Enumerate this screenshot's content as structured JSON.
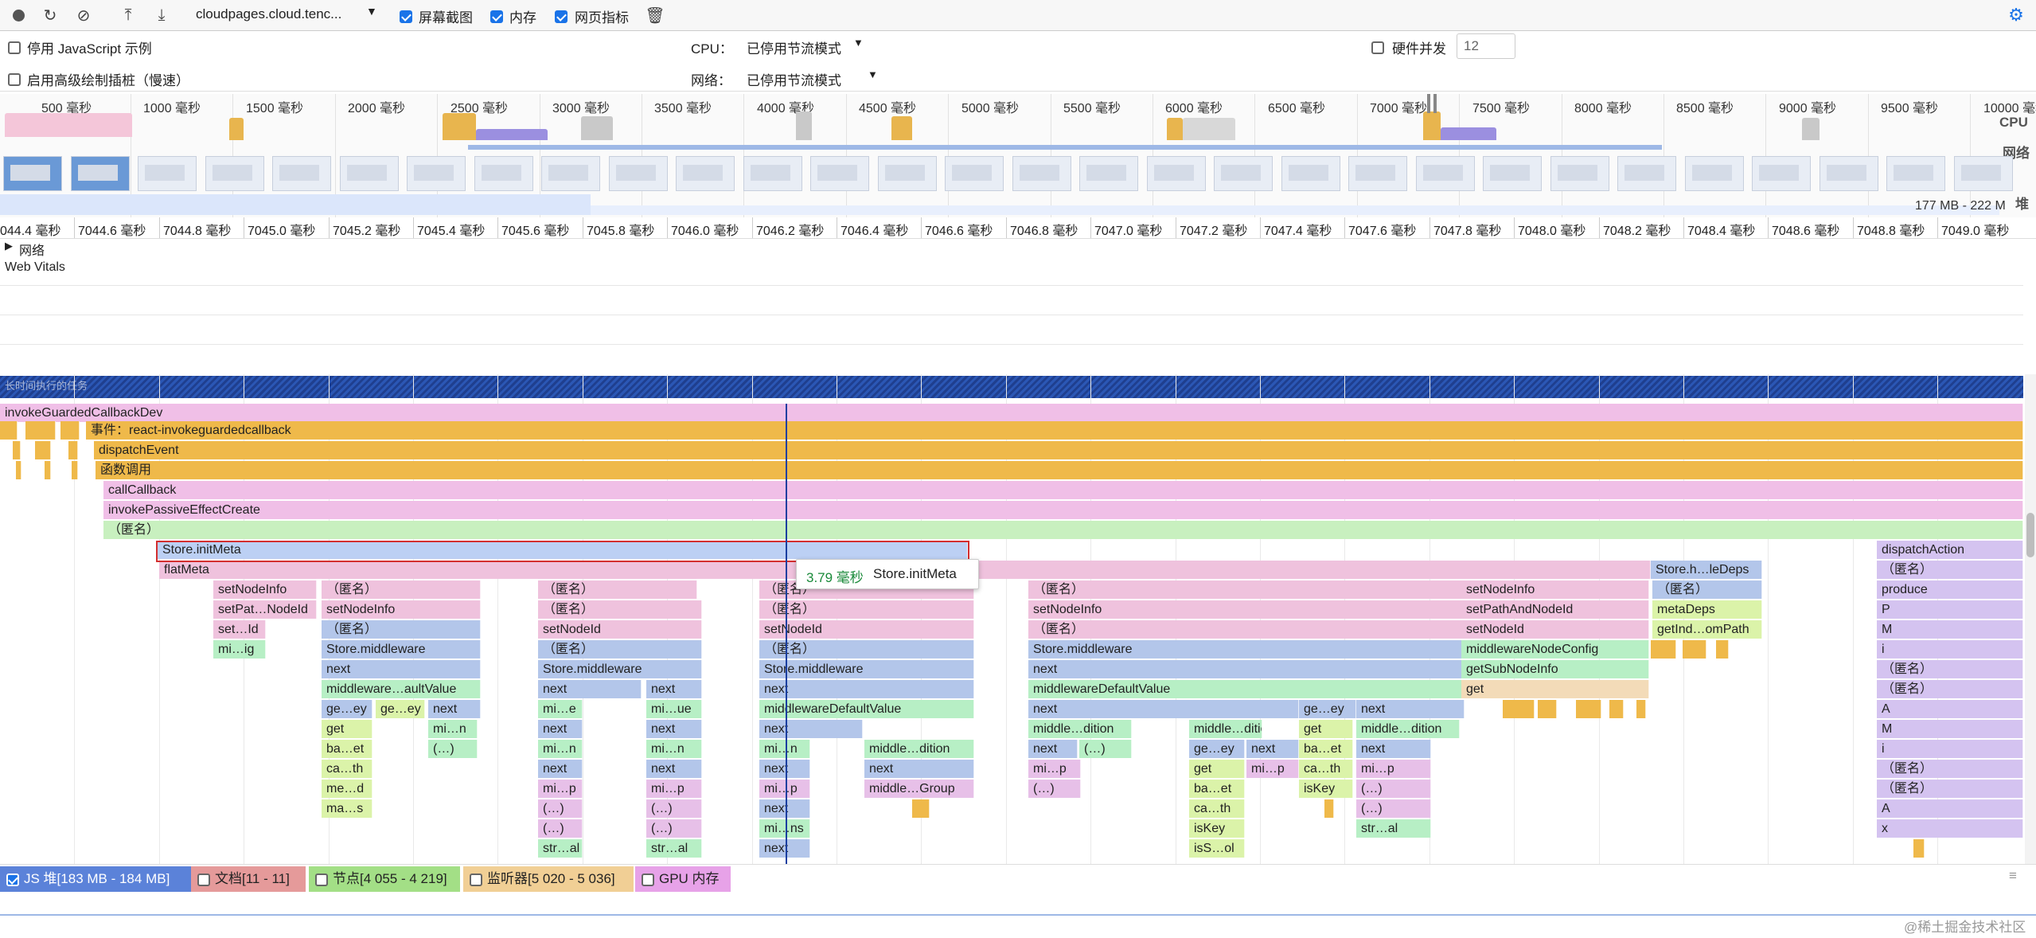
{
  "toolbar": {
    "url_select": "cloudpages.cloud.tenc...",
    "screenshots_label": "屏幕截图",
    "memory_label": "内存",
    "web_vitals_label": "网页指标"
  },
  "settings": {
    "disable_js_samples": "停用 JavaScript 示例",
    "advanced_paint": "启用高级绘制插桩（慢速）",
    "cpu_label": "CPU：",
    "cpu_value": "已停用节流模式",
    "network_label": "网络：",
    "network_value": "已停用节流模式",
    "hw_concurrency_label": "硬件并发",
    "hw_concurrency_value": "12"
  },
  "overview": {
    "ruler": [
      "500 毫秒",
      "1000 毫秒",
      "1500 毫秒",
      "2000 毫秒",
      "2500 毫秒",
      "3000 毫秒",
      "3500 毫秒",
      "4000 毫秒",
      "4500 毫秒",
      "5000 毫秒",
      "5500 毫秒",
      "6000 毫秒",
      "6500 毫秒",
      "7000 毫秒",
      "7500 毫秒",
      "8000 毫秒",
      "8500 毫秒",
      "9000 毫秒",
      "9500 毫秒",
      "10000 毫秒"
    ],
    "cpu_label": "CPU",
    "network_label": "网络",
    "heap_label": "堆",
    "heap_range": "177 MB - 222 M"
  },
  "time_ruler": [
    "044.4 毫秒",
    "7044.6 毫秒",
    "7044.8 毫秒",
    "7045.0 毫秒",
    "7045.2 毫秒",
    "7045.4 毫秒",
    "7045.6 毫秒",
    "7045.8 毫秒",
    "7046.0 毫秒",
    "7046.2 毫秒",
    "7046.4 毫秒",
    "7046.6 毫秒",
    "7046.8 毫秒",
    "7047.0 毫秒",
    "7047.2 毫秒",
    "7047.4 毫秒",
    "7047.6 毫秒",
    "7047.8 毫秒",
    "7048.0 毫秒",
    "7048.2 毫秒",
    "7048.4 毫秒",
    "7048.6 毫秒",
    "7048.8 毫秒",
    "7049.0 毫秒"
  ],
  "tracks": {
    "network": "网络",
    "web_vitals": "Web Vitals",
    "long_task": "长时间执行的任务"
  },
  "flame": {
    "l0": "invokeGuardedCallbackDev",
    "l1": "事件：react-invokeguardedcallback",
    "l2": "dispatchEvent",
    "l3": "函数调用",
    "l4": "callCallback",
    "l5": "invokePassiveEffectCreate",
    "l6": "（匿名）",
    "init_meta": "Store.initMeta",
    "dispatch_action": "dispatchAction",
    "flat_meta": "flatMeta",
    "store_h": "Store.h…leDeps",
    "anon": "（匿名）",
    "setNodeInfo": "setNodeInfo",
    "setPatNode": "setPat…NodeId",
    "setNodeId": "setNodeId",
    "setId": "set…Id",
    "miig": "mi…ig",
    "storeMiddleware": "Store.middleware",
    "next": "next",
    "mwDefault": "middleware…aultValue",
    "mwDefaultFull": "middlewareDefaultValue",
    "geey": "ge…ey",
    "get": "get",
    "baet": "ba…et",
    "cath": "ca…th",
    "med": "me…d",
    "mas": "ma…s",
    "min": "mi…n",
    "ellipsis": "(…)",
    "mie": "mi…e",
    "miue": "mi…ue",
    "mip": "mi…p",
    "stral": "str…al",
    "mins": "mi…ns",
    "mwDition": "middle…dition",
    "mwGroup": "middle…Group",
    "setPathAndNodeId": "setPathAndNodeId",
    "mwNodeConfig": "middlewareNodeConfig",
    "getSubNodeInfo": "getSubNodeInfo",
    "metaDeps": "metaDeps",
    "getIndOmPath": "getInd…omPath",
    "isKey": "isKey",
    "isSol": "isS…ol",
    "produce": "produce",
    "P": "P",
    "M": "M",
    "i": "i",
    "A": "A",
    "x": "x"
  },
  "tooltip": {
    "duration": "3.79 毫秒",
    "name": "Store.initMeta"
  },
  "counters": {
    "js_heap": "JS 堆[183 MB - 184 MB]",
    "documents": "文档[11 - 11]",
    "nodes": "节点[4 055 - 4 219]",
    "listeners": "监听器[5 020 - 5 036]",
    "gpu": "GPU 内存"
  },
  "watermark": "@稀土掘金技术社区",
  "colors": {
    "accent": "#1a73e8",
    "selection_border": "#d32f2f",
    "long_task": "#1f3f8f"
  }
}
